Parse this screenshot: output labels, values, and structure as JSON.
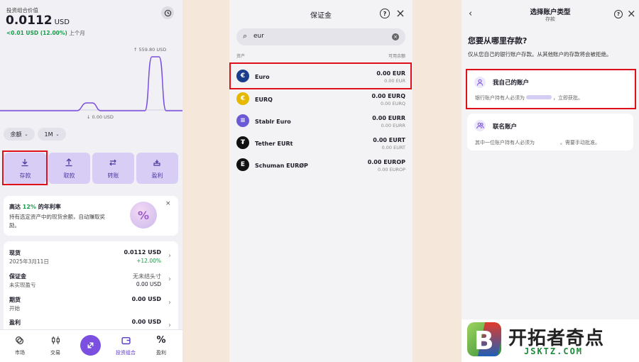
{
  "portfolio": {
    "title": "投资组合价值",
    "value": "0.0112",
    "currency": "USD",
    "change": "<0.01 USD (12.00%)",
    "period_suffix": "上个月",
    "chart_max": "↑ 559.80 USD",
    "chart_min": "↓ 0.00 USD",
    "filter_balance": "余额",
    "filter_range": "1M",
    "actions": [
      "存款",
      "取款",
      "转账",
      "盈利"
    ],
    "promo": {
      "title_pre": "高达 ",
      "title_rate": "12%",
      "title_post": " 的年利率",
      "body_line1": "持有选定资产中的现货余额，自动赚取奖",
      "body_line2": "励。"
    },
    "rows": [
      {
        "name": "现货",
        "sub": "2025年3月11日",
        "value": "0.0112 USD",
        "change": "+12.00%"
      },
      {
        "name": "保证金",
        "sub": "未实现盈亏",
        "value": "无未结头寸",
        "change": "0.00 USD"
      },
      {
        "name": "期货",
        "sub": "开始",
        "value": "0.00 USD",
        "change": ""
      },
      {
        "name": "盈利",
        "sub": "",
        "value": "0.00 USD",
        "change": ""
      }
    ],
    "nav": [
      "市场",
      "交易",
      "",
      "投资组合",
      "盈利"
    ]
  },
  "margin": {
    "title": "保证金",
    "search_value": "eur",
    "col_asset": "资产",
    "col_available": "可用余额",
    "assets": [
      {
        "name": "Euro",
        "value": "0.00 EUR",
        "sub": "0.00 EUR",
        "color": "#1a3e8c",
        "glyph": "€"
      },
      {
        "name": "EURQ",
        "value": "0.00 EURQ",
        "sub": "0.00 EURQ",
        "color": "#e6b800",
        "glyph": "€"
      },
      {
        "name": "Stablr Euro",
        "value": "0.00 EURR",
        "sub": "0.00 EURR",
        "color": "#6a5ad6",
        "glyph": "≡"
      },
      {
        "name": "Tether EURt",
        "value": "0.00 EURT",
        "sub": "0.00 EURT",
        "color": "#111",
        "glyph": "₮"
      },
      {
        "name": "Schuman EURØP",
        "value": "0.00 EUROP",
        "sub": "0.00 EUROP",
        "color": "#111",
        "glyph": "E"
      }
    ]
  },
  "account": {
    "title": "选择账户类型",
    "subtitle": "存款",
    "heading": "您要从哪里存款?",
    "desc": "仅从您自己的银行账户存款。从其他账户的存款将会被拒绝。",
    "options": [
      {
        "title": "我自己的账户",
        "body_pre": "银行账户持有人必须为",
        "body_post": "，立即获批。"
      },
      {
        "title": "联名账户",
        "body_pre": "其中一位账户持有人必须为",
        "body_post": "。需要手动批准。"
      }
    ]
  },
  "watermark": {
    "name": "开拓者奇点",
    "url": "JSKTZ.COM",
    "colors": {
      "green": "#7cc242",
      "red": "#e23a2b",
      "blue": "#1f5fb5"
    }
  },
  "colors": {
    "accent": "#7b4fe0",
    "highlight": "#e0101a",
    "positive": "#1a9a4b"
  }
}
